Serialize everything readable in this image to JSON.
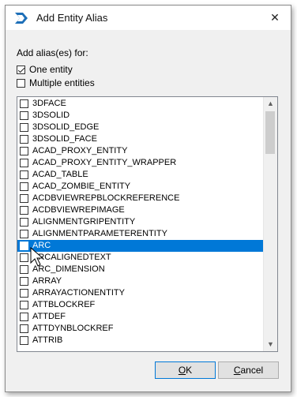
{
  "window": {
    "title": "Add Entity Alias",
    "close_glyph": "✕",
    "app_icon": "bricscad-logo-icon"
  },
  "form": {
    "label": "Add alias(es) for:",
    "options": [
      {
        "label": "One entity",
        "checked": true
      },
      {
        "label": "Multiple entities",
        "checked": false
      }
    ]
  },
  "entities": [
    "3DFACE",
    "3DSOLID",
    "3DSOLID_EDGE",
    "3DSOLID_FACE",
    "ACAD_PROXY_ENTITY",
    "ACAD_PROXY_ENTITY_WRAPPER",
    "ACAD_TABLE",
    "ACAD_ZOMBIE_ENTITY",
    "ACDBVIEWREPBLOCKREFERENCE",
    "ACDBVIEWREPIMAGE",
    "ALIGNMENTGRIPENTITY",
    "ALIGNMENTPARAMETERENTITY",
    "ARC",
    "ARCALIGNEDTEXT",
    "ARC_DIMENSION",
    "ARRAY",
    "ARRAYACTIONENTITY",
    "ATTBLOCKREF",
    "ATTDEF",
    "ATTDYNBLOCKREF",
    "ATTRIB"
  ],
  "selected_entity": "ARC",
  "colors": {
    "selection": "#0078d7"
  },
  "buttons": {
    "ok": {
      "mnemonic": "O",
      "rest": "K"
    },
    "cancel": {
      "mnemonic": "C",
      "rest": "ancel"
    }
  }
}
